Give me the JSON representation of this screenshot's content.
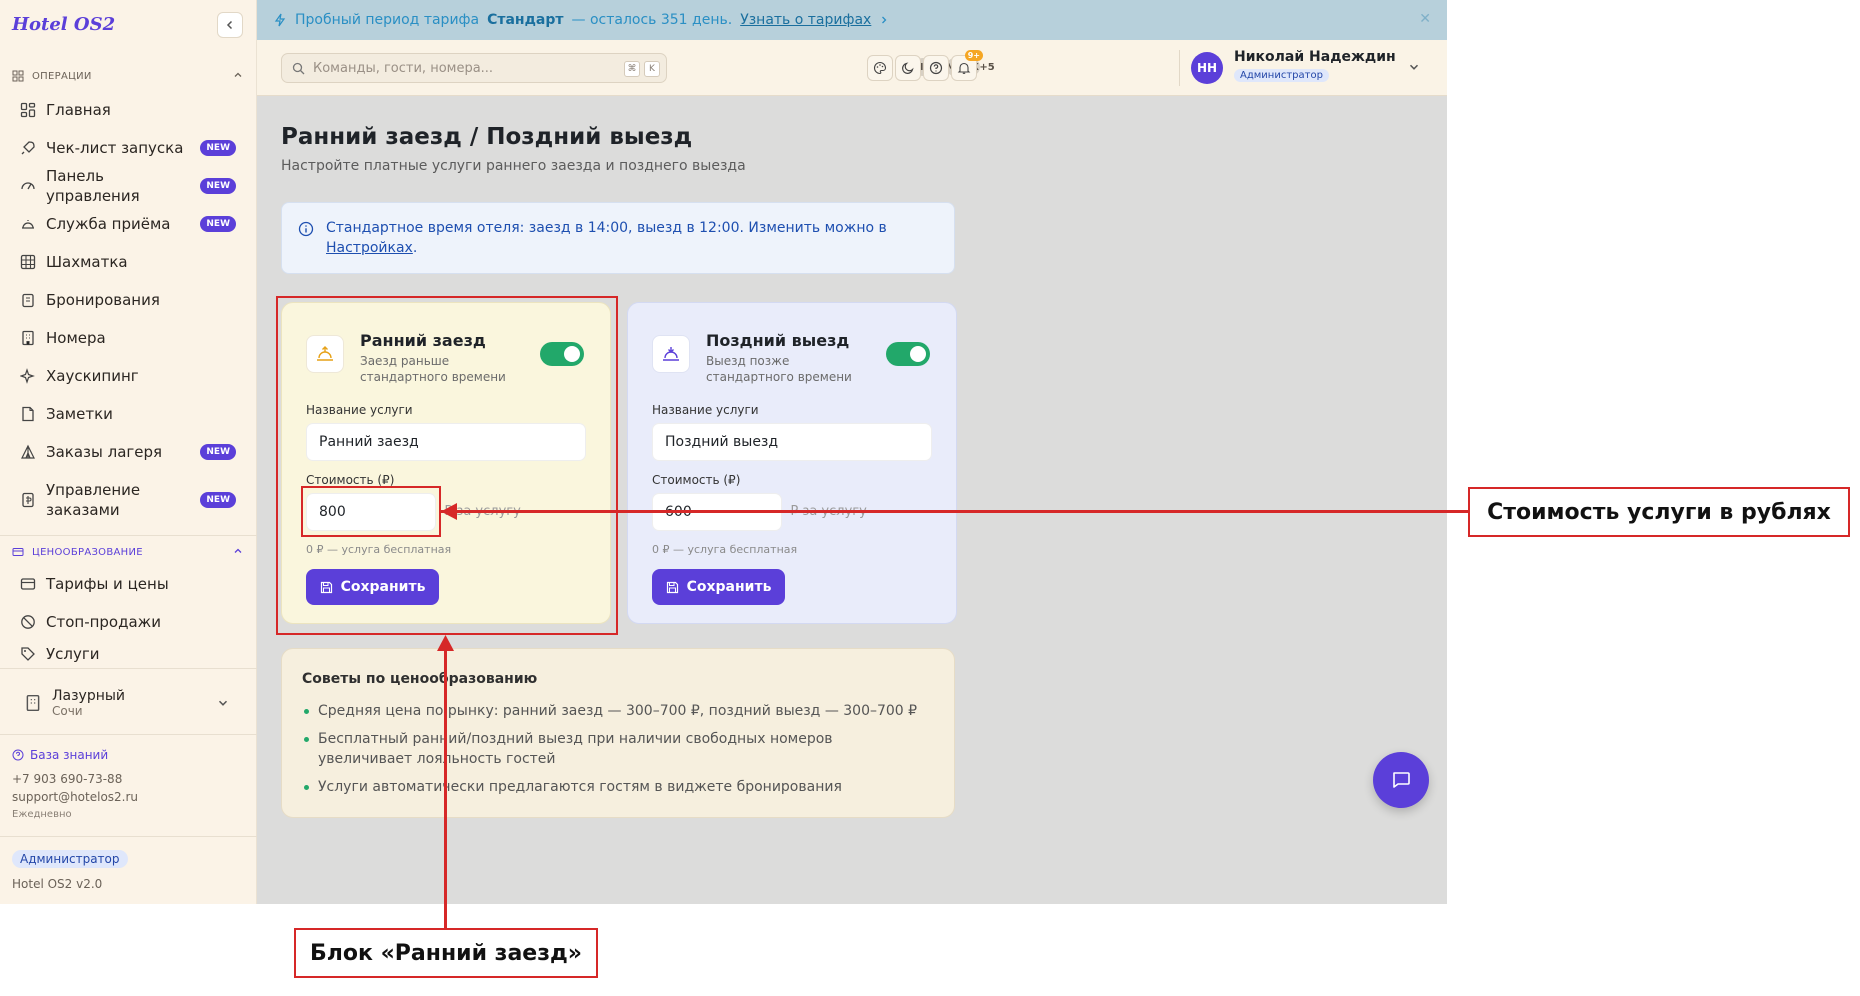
{
  "app": {
    "logo": "Hotel OS2"
  },
  "banner": {
    "text_before": "Пробный период тарифа",
    "plan": "Стандарт",
    "text_after": "— осталось 351 день.",
    "link": "Узнать о тарифах"
  },
  "sidebar": {
    "section_operations": "ОПЕРАЦИИ",
    "items": [
      {
        "label": "Главная",
        "icon": "grid-icon",
        "badge": ""
      },
      {
        "label": "Чек-лист запуска",
        "icon": "rocket-icon",
        "badge": "NEW"
      },
      {
        "label": "Панель управления",
        "icon": "gauge-icon",
        "badge": "NEW"
      },
      {
        "label": "Служба приёма",
        "icon": "bell-icon",
        "badge": "NEW"
      },
      {
        "label": "Шахматка",
        "icon": "table-icon",
        "badge": ""
      },
      {
        "label": "Бронирования",
        "icon": "clipboard-icon",
        "badge": ""
      },
      {
        "label": "Номера",
        "icon": "building-icon",
        "badge": ""
      },
      {
        "label": "Хаускипинг",
        "icon": "sparkle-icon",
        "badge": ""
      },
      {
        "label": "Заметки",
        "icon": "note-icon",
        "badge": ""
      },
      {
        "label": "Заказы лагеря",
        "icon": "tent-icon",
        "badge": "NEW"
      },
      {
        "label": "Управление заказами",
        "icon": "receipt-icon",
        "badge": "NEW"
      }
    ],
    "section_pricing": "ЦЕНООБРАЗОВАНИЕ",
    "pricing_items": [
      {
        "label": "Тарифы и цены",
        "icon": "card-icon"
      },
      {
        "label": "Стоп-продажи",
        "icon": "ban-icon"
      },
      {
        "label": "Услуги",
        "icon": "tag-icon"
      }
    ],
    "hotel": {
      "name": "Лазурный",
      "city": "Сочи"
    },
    "knowledge_base": "База знаний",
    "phone": "+7 903 690-73-88",
    "email": "support@hotelos2.ru",
    "schedule": "Ежедневно",
    "role": "Администратор",
    "version": "Hotel OS2 v2.0"
  },
  "topbar": {
    "search_placeholder": "Команды, гости, номера...",
    "kbd_1": "⌘",
    "kbd_2": "K",
    "avatars": [
      "ИС",
      "ОС",
      "МИ",
      "АК"
    ],
    "avatars_more": "+5",
    "notif_count": "9+",
    "user_initials": "НН",
    "user_name": "Николай Надеждин",
    "user_role": "Администратор"
  },
  "page": {
    "title": "Ранний заезд / Поздний выезд",
    "subtitle": "Настройте платные услуги раннего заезда и позднего выезда",
    "info_text": "Стандартное время отеля: заезд в 14:00, выезд в 12:00. Изменить можно в ",
    "info_link": "Настройках",
    "info_end": "."
  },
  "early_card": {
    "title": "Ранний заезд",
    "desc": "Заезд раньше стандартного времени",
    "enabled": true,
    "name_label": "Название услуги",
    "name_value": "Ранний заезд",
    "price_label": "Стоимость (₽)",
    "price_value": "800",
    "unit": "₽ за услугу",
    "hint": "0 ₽ — услуга бесплатная",
    "save": "Сохранить"
  },
  "late_card": {
    "title": "Поздний выезд",
    "desc": "Выезд позже стандартного времени",
    "enabled": true,
    "name_label": "Название услуги",
    "name_value": "Поздний выезд",
    "price_label": "Стоимость (₽)",
    "price_value": "600",
    "unit": "₽ за услугу",
    "hint": "0 ₽ — услуга бесплатная",
    "save": "Сохранить"
  },
  "tips": {
    "title": "Советы по ценообразованию",
    "items": [
      "Средняя цена по рынку: ранний заезд — 300–700 ₽, поздний выезд — 300–700 ₽",
      "Бесплатный ранний/поздний выезд при наличии свободных номеров увеличивает лояльность гостей",
      "Услуги автоматически предлагаются гостям в виджете бронирования"
    ]
  },
  "annotations": {
    "price_callout": "Стоимость услуги в рублях",
    "block_callout": "Блок «Ранний заезд»"
  },
  "colors": {
    "accent": "#5b3fd9",
    "toggle_on": "#22a86a",
    "annotation": "#d62828"
  }
}
